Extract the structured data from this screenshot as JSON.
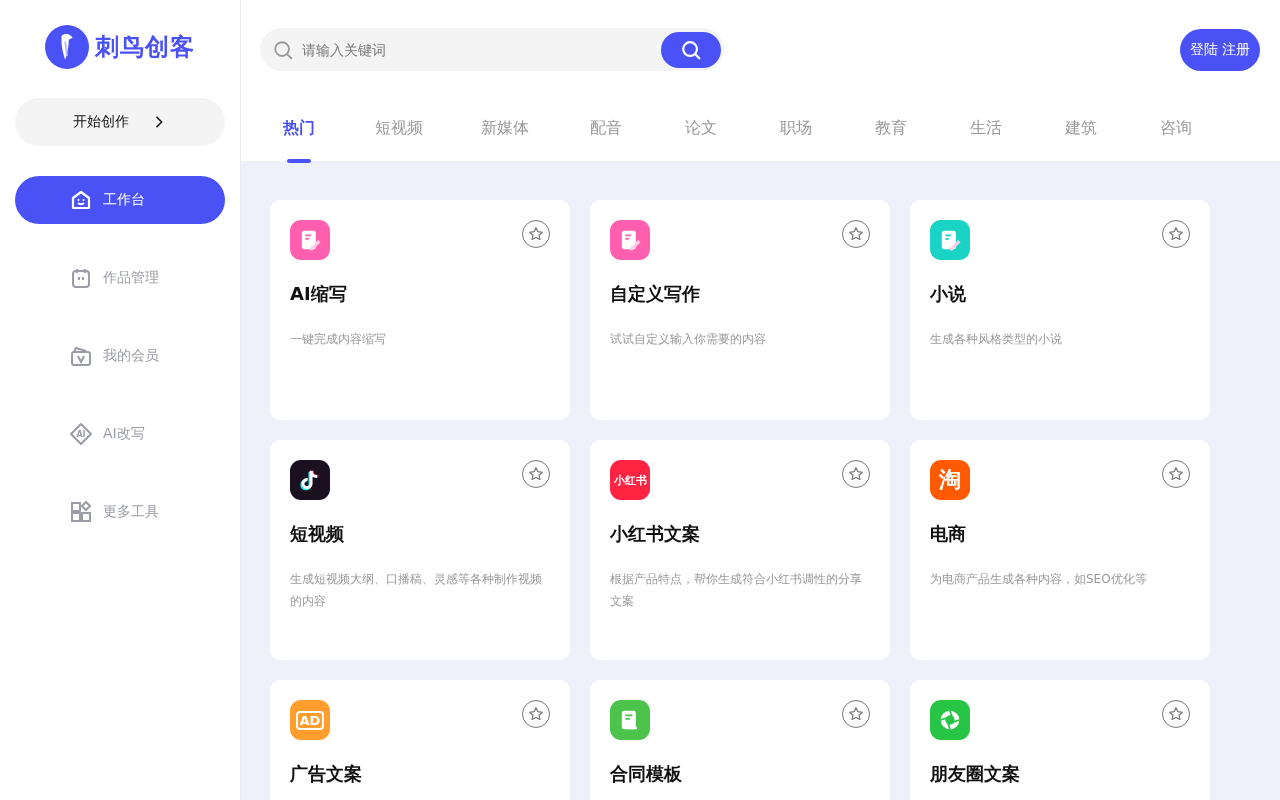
{
  "logo": {
    "text": "刺鸟创客"
  },
  "start_button": {
    "label": "开始创作"
  },
  "nav": [
    {
      "label": "工作台",
      "kind": "home",
      "selected": true
    },
    {
      "label": "作品管理",
      "kind": "calendar",
      "selected": false
    },
    {
      "label": "我的会员",
      "kind": "vip",
      "selected": false
    },
    {
      "label": "AI改写",
      "kind": "ai",
      "icon_text": "AI",
      "selected": false
    },
    {
      "label": "更多工具",
      "kind": "grid",
      "selected": false
    }
  ],
  "search": {
    "placeholder": "请输入关键词"
  },
  "auth_button": {
    "label": "登陆 注册"
  },
  "tabs": [
    {
      "label": "热门",
      "selected": true
    },
    {
      "label": "短视频",
      "selected": false
    },
    {
      "label": "新媒体",
      "selected": false
    },
    {
      "label": "配音",
      "selected": false
    },
    {
      "label": "论文",
      "selected": false
    },
    {
      "label": "职场",
      "selected": false
    },
    {
      "label": "教育",
      "selected": false
    },
    {
      "label": "生活",
      "selected": false
    },
    {
      "label": "建筑",
      "selected": false
    },
    {
      "label": "咨询",
      "selected": false
    }
  ],
  "cards": [
    {
      "title": "AI缩写",
      "description": "一键完成内容缩写",
      "kind": "doc",
      "color": "#ff5fae"
    },
    {
      "title": "自定义写作",
      "description": "试试自定义输入你需要的内容",
      "kind": "doc",
      "color": "#ff5fae"
    },
    {
      "title": "小说",
      "description": "生成各种风格类型的小说",
      "kind": "doc",
      "color": "#19d4c4"
    },
    {
      "title": "短视频",
      "description": "生成短视频大纲、口播稿、灵感等各种制作视频的内容",
      "kind": "note",
      "color": "#1a1020"
    },
    {
      "title": "小红书文案",
      "description": "根据产品特点，帮你生成符合小红书调性的分享文案",
      "kind": "text",
      "icon_text": "小红书",
      "color": "#ff2442"
    },
    {
      "title": "电商",
      "description": "为电商产品生成各种内容，如SEO优化等",
      "kind": "text",
      "icon_text": "淘",
      "color": "#ff5a00"
    },
    {
      "title": "广告文案",
      "kind": "text",
      "icon_text": "AD",
      "color": "#ff9e2c"
    },
    {
      "title": "合同模板",
      "kind": "contract",
      "color": "#4cc44c"
    },
    {
      "title": "朋友圈文案",
      "kind": "shutter",
      "color": "#27c445"
    }
  ]
}
